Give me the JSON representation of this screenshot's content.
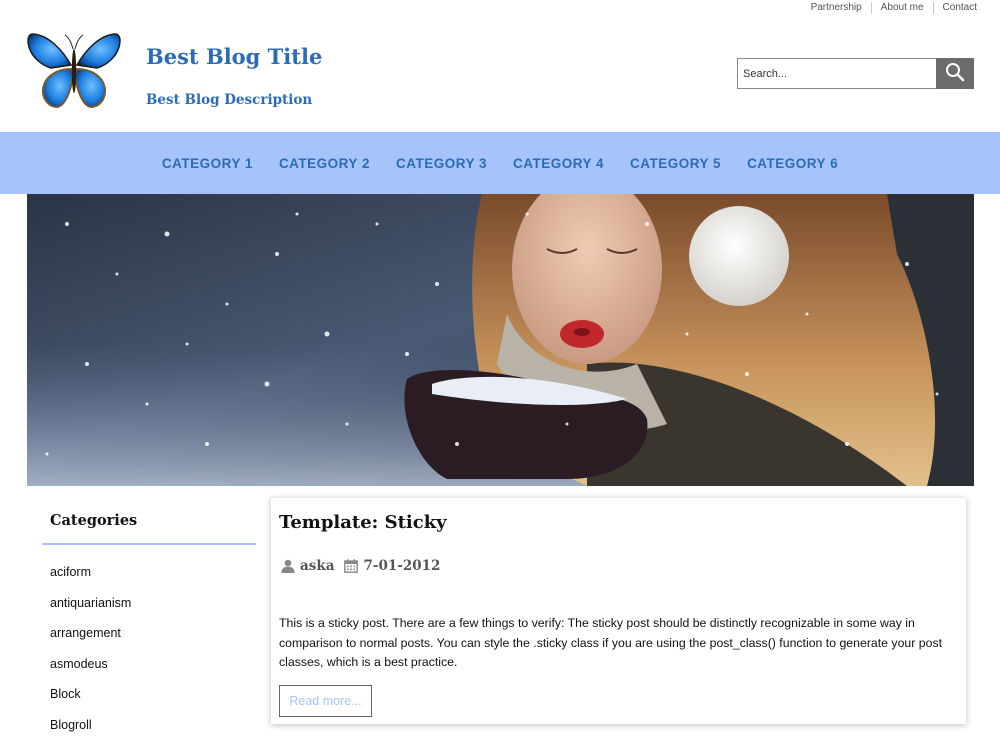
{
  "top_links": [
    "Partnership",
    "About me",
    "Contact"
  ],
  "site": {
    "title": "Best Blog Title",
    "description": "Best Blog Description"
  },
  "search": {
    "placeholder": "Search...",
    "icon": "magnifier-icon"
  },
  "nav": [
    "CATEGORY 1",
    "CATEGORY 2",
    "CATEGORY 3",
    "CATEGORY 4",
    "CATEGORY 5",
    "CATEGORY 6"
  ],
  "sidebar": {
    "heading": "Categories",
    "items": [
      "aciform",
      "antiquarianism",
      "arrangement",
      "asmodeus",
      "Block",
      "Blogroll"
    ]
  },
  "post": {
    "title": "Template: Sticky",
    "author": "aska",
    "date": "7-01-2012",
    "excerpt": "This is a sticky post. There are a few things to verify: The sticky post should be distinctly recognizable in some way in comparison to normal posts. You can style the .sticky class if you are using the post_class() function to generate your post classes, which is a best practice.",
    "read_more": "Read more..."
  },
  "colors": {
    "accent": "#2b6cb5",
    "nav_bg": "#a6c4fb"
  }
}
